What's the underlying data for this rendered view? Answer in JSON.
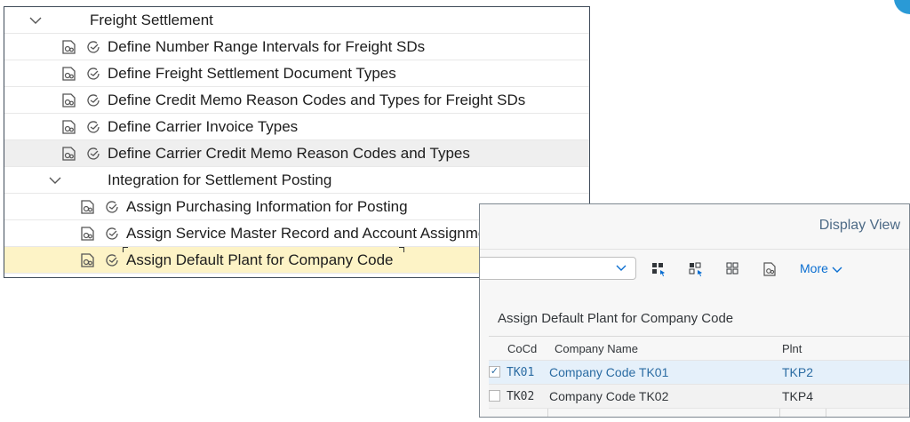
{
  "tree": {
    "rows": [
      {
        "label": "Freight Settlement",
        "type": "folder"
      },
      {
        "label": "Define Number Range Intervals for Freight SDs",
        "type": "activity"
      },
      {
        "label": "Define Freight Settlement Document Types",
        "type": "activity"
      },
      {
        "label": "Define Credit Memo Reason Codes and Types for Freight SDs",
        "type": "activity"
      },
      {
        "label": "Define Carrier Invoice Types",
        "type": "activity"
      },
      {
        "label": "Define Carrier Credit Memo Reason Codes and Types",
        "type": "activity"
      },
      {
        "label": "Integration for Settlement Posting",
        "type": "folder"
      },
      {
        "label": "Assign Purchasing Information for Posting",
        "type": "activity"
      },
      {
        "label": "Assign Service Master Record and Account Assignment Category",
        "type": "activity"
      },
      {
        "label": "Assign Default Plant for Company Code",
        "type": "activity",
        "selected": true
      }
    ],
    "icons": [
      "execute-document-icon",
      "clock-check-icon",
      "chevron-down-icon"
    ]
  },
  "view": {
    "title": "Display View",
    "toolbar": {
      "more_label": "More"
    },
    "section_title": "Assign Default Plant for Company Code",
    "columns": [
      "CoCd",
      "Company Name",
      "Plnt"
    ],
    "rows": [
      {
        "cocd": "TK01",
        "name": "Company Code TK01",
        "plnt": "TKP2",
        "checked": true
      },
      {
        "cocd": "TK02",
        "name": "Company Code TK02",
        "plnt": "TKP4",
        "checked": false
      }
    ]
  },
  "colors": {
    "selected_row": "#fdf3c6",
    "link": "#2b6ca3",
    "accent": "#0a6ed1"
  }
}
